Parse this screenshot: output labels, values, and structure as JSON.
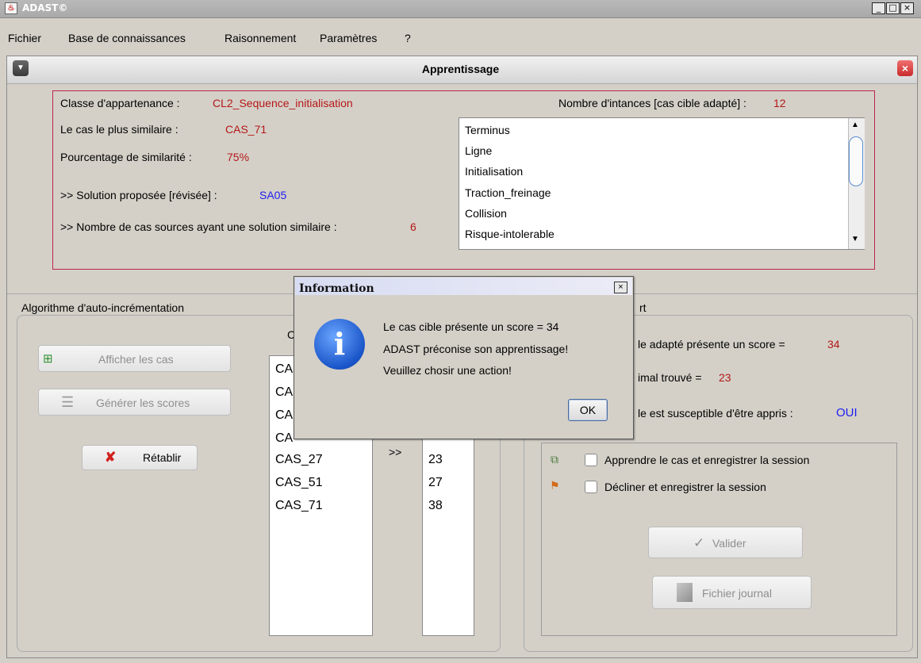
{
  "window": {
    "title": "ADAST©",
    "controls": [
      "_",
      "□",
      "×"
    ]
  },
  "menu": {
    "items": [
      "Fichier",
      "Base de connaissances",
      "Raisonnement",
      "Paramètres",
      "?"
    ]
  },
  "frame": {
    "title": "Apprentissage"
  },
  "summary": {
    "classe_label": "Classe d'appartenance :",
    "classe_value": "CL2_Sequence_initialisation",
    "plus_similaire_label": "Le cas le plus similaire :",
    "plus_similaire_value": "CAS_71",
    "pourcentage_label": "Pourcentage de similarité :",
    "pourcentage_value": "75%",
    "solution_label": ">> Solution proposée [révisée] :",
    "solution_value": "SA05",
    "nb_sources_label": ">> Nombre de cas sources ayant  une solution similaire :",
    "nb_sources_value": "6",
    "nb_instances_label": "Nombre d'intances [cas cible adapté] :",
    "nb_instances_value": "12",
    "instances": [
      "Terminus",
      "Ligne",
      "Initialisation",
      "Traction_freinage",
      "Collision",
      "Risque-intolerable"
    ]
  },
  "left_panel": {
    "title": "Algorithme d'auto-incrémentation",
    "col_header": "C",
    "afficher_label": "Afficher les cas",
    "generer_label": "Générer les scores",
    "retablir_label": "Rétablir",
    "arrow": ">>",
    "cases": [
      "CA",
      "CA",
      "CA",
      "CA",
      "CAS_27",
      "CAS_51",
      "CAS_71"
    ],
    "scores": [
      "23",
      "27",
      "38"
    ]
  },
  "right_panel": {
    "title_fragment": "rt",
    "score_label": "le adapté présente un score =",
    "score_value": "34",
    "minimal_label": "imal trouvé =",
    "minimal_value": "23",
    "susceptible_label": "le est susceptible d'être appris :",
    "susceptible_value": "OUI",
    "option_learn": "Apprendre le cas et enregistrer la session",
    "option_decline": "Décliner et enregistrer la session",
    "valider_label": "Valider",
    "journal_label": "Fichier journal"
  },
  "dialog": {
    "title": "Information",
    "line1": "Le cas cible présente un score = 34",
    "line2": " ADAST préconise son apprentissage!",
    "line3": "Veuillez chosir une action!",
    "ok_label": "OK"
  },
  "colors": {
    "red_value": "#b41717",
    "blue_value": "#1c1cf0",
    "frame_border": "#c0244a"
  }
}
